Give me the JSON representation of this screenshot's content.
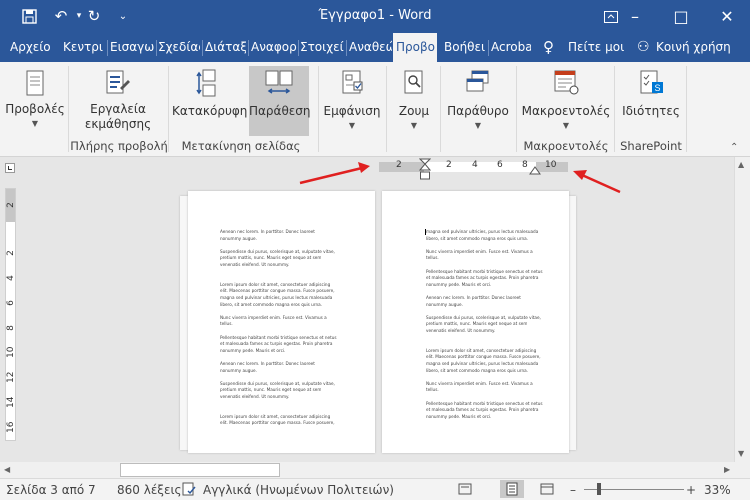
{
  "window": {
    "title": "Έγγραφο1 - Word",
    "restore_icon": "ribbon-display-icon",
    "controls": [
      "–",
      "□",
      "✕"
    ]
  },
  "quick_access": [
    "save-icon",
    "undo-icon",
    "redo-icon",
    "customize-icon"
  ],
  "tabs": [
    {
      "label": "Αρχείο"
    },
    {
      "label": "Κεντρι"
    },
    {
      "label": "Εισαγω"
    },
    {
      "label": "Σχεδίας"
    },
    {
      "label": "Διάταξ"
    },
    {
      "label": "Αναφορ"
    },
    {
      "label": "Στοιχεί"
    },
    {
      "label": "Αναθεώ"
    },
    {
      "label": "Προβο"
    },
    {
      "label": "Βοήθει"
    },
    {
      "label": "Acroba"
    },
    {
      "label": "Πείτε μοι"
    },
    {
      "label": "Κοινή χρήση"
    }
  ],
  "ribbon": {
    "views_label": "Προβολές",
    "learning_tools": "Εργαλεία εκμάθησης",
    "immersive_group": "Πλήρης προβολή",
    "vertical": "Κατακόρυφη",
    "side_by_side": "Παράθεση",
    "page_movement_group": "Μετακίνηση σελίδας",
    "show": "Εμφάνιση",
    "zoom": "Ζουμ",
    "window": "Παράθυρο",
    "macros": "Μακροεντολές",
    "macros_group": "Μακροεντολές",
    "properties": "Ιδιότητες",
    "sharepoint_group": "SharePoint"
  },
  "ruler": {
    "h_numbers": [
      "2",
      "2",
      "4",
      "6",
      "8",
      "10"
    ],
    "v_numbers": [
      "2",
      "2",
      "4",
      "6",
      "8",
      "10",
      "12",
      "14",
      "16"
    ]
  },
  "page_left": {
    "lines": [
      "Aenean nec lorem. In porttitor. Donec laoreet",
      "nonummy augue.",
      "",
      "Suspendisse dui purus, scelerisque at, vulputate vitae,",
      "pretium mattis, nunc. Mauris eget neque at sem",
      "venenatis eleifend. Ut nonummy.",
      "",
      "",
      "Lorem ipsum dolor sit amet, consectetuer adipiscing",
      "elit. Maecenas porttitor congue massa. Fusce posuere,",
      "magna sed pulvinar ultricies, purus lectus malesuada",
      "libero, sit amet commodo magna eros quis urna.",
      "",
      "Nunc viverra imperdiet enim. Fusce est. Vivamus a",
      "tellus.",
      "",
      "Pellentesque habitant morbi tristique senectus et netus",
      "et malesuada fames ac turpis egestas. Proin pharetra",
      "nonummy pede. Mauris et orci.",
      "",
      "Aenean nec lorem. In porttitor. Donec laoreet",
      "nonummy augue.",
      "",
      "Suspendisse dui purus, scelerisque at, vulputate vitae,",
      "pretium mattis, nunc. Mauris eget neque at sem",
      "venenatis eleifend. Ut nonummy.",
      "",
      "",
      "Lorem ipsum dolor sit amet, consectetuer adipiscing",
      "elit. Maecenas porttitor congue massa. Fusce posuere,"
    ]
  },
  "page_right": {
    "lines": [
      "magna sed pulvinar ultricies, purus lectus malesuada",
      "libero, sit amet commodo magna eros quis urna.",
      "",
      "Nunc viverra imperdiet enim. Fusce est. Vivamus a",
      "tellus.",
      "",
      "Pellentesque habitant morbi tristique senectus et netus",
      "et malesuada fames ac turpis egestas. Proin pharetra",
      "nonummy pede. Mauris et orci.",
      "",
      "Aenean nec lorem. In porttitor. Donec laoreet",
      "nonummy augue.",
      "",
      "Suspendisse dui purus, scelerisque at, vulputate vitae,",
      "pretium mattis, nunc. Mauris eget neque at sem",
      "venenatis eleifend. Ut nonummy.",
      "",
      "",
      "Lorem ipsum dolor sit amet, consectetuer adipiscing",
      "elit. Maecenas porttitor congue massa. Fusce posuere,",
      "magna sed pulvinar ultricies, purus lectus malesuada",
      "libero, sit amet commodo magna eros quis urna.",
      "",
      "Nunc viverra imperdiet enim. Fusce est. Vivamus a",
      "tellus.",
      "",
      "Pellentesque habitant morbi tristique senectus et netus",
      "et malesuada fames ac turpis egestas. Proin pharetra",
      "nonummy pede. Mauris et orci."
    ]
  },
  "status": {
    "page": "Σελίδα 3 από 7",
    "words": "860 λέξεις",
    "language": "Αγγλικά (Ηνωμένων Πολιτειών)",
    "zoom": "33%",
    "minus": "–",
    "plus": "+"
  },
  "colors": {
    "titlebar": "#2b579a",
    "annotation_arrow": "#e02020"
  }
}
